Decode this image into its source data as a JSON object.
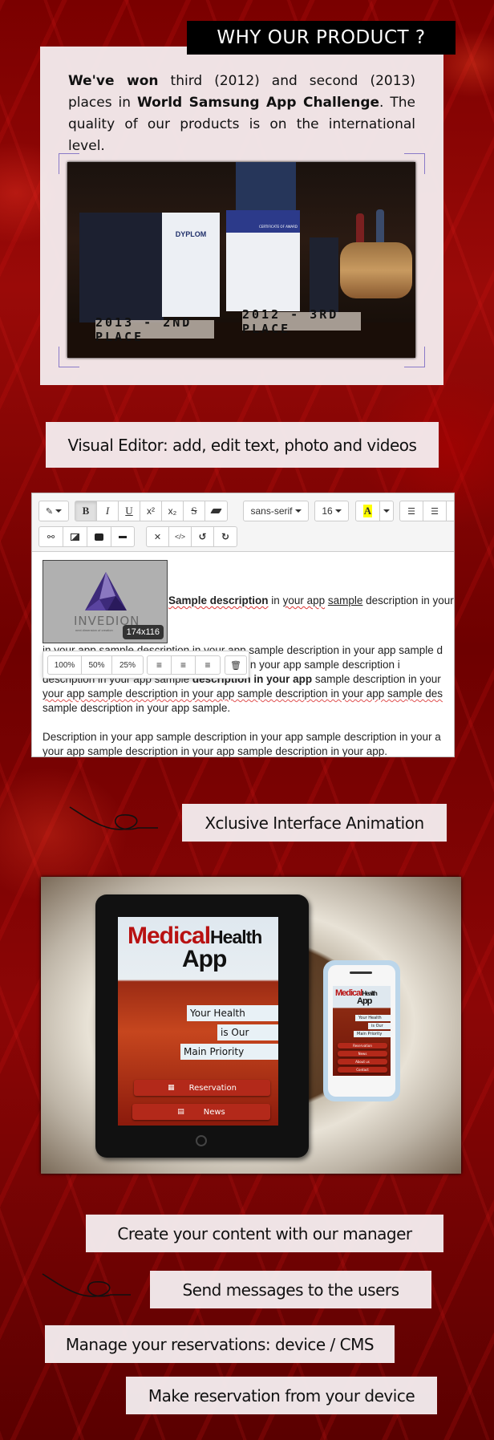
{
  "why_section": {
    "title": "WHY OUR PRODUCT ?",
    "text_bold_1": "We've won",
    "text_1": " third (2012) and second (2013) places in ",
    "text_bold_2": "World Samsung App Challenge",
    "text_2": ". The quality of our products is on the international level.",
    "award_labels": [
      "2013 - 2ND PLACE",
      "2012 - 3RD PLACE"
    ],
    "photo_props": {
      "diploma_title": "DYPLOM",
      "certificate_title": "CERTIFICATE OF AWARD"
    }
  },
  "features": {
    "visual_editor": "Visual Editor: add, edit text, photo and videos",
    "animation": "Xclusive Interface Animation",
    "content_manager": "Create your content with our manager",
    "messages": "Send messages to the users",
    "manage_reservations": "Manage your reservations: device / CMS",
    "make_reservation": "Make reservation from your device"
  },
  "editor": {
    "toolbar": {
      "style_icon": "magic-wand-icon",
      "bold": "B",
      "italic": "I",
      "underline": "U",
      "superscript": "x²",
      "subscript": "x₂",
      "strikethrough": "S",
      "font_family": "sans-serif",
      "font_size": "16",
      "color_letter": "A",
      "highlight_color": "#ffff00"
    },
    "image": {
      "logo_text": "INVEDION",
      "logo_tagline": "next dimension of creation",
      "size_badge": "174x116"
    },
    "image_popover": {
      "sizes": [
        "100%",
        "50%",
        "25%"
      ]
    },
    "content": {
      "heading_bold": "Sample description",
      "heading_rest_a": " in ",
      "heading_rest_b": "your app",
      "heading_rest_c": " ",
      "heading_underlined": "sample",
      "heading_rest_d": " description in your",
      "para1_line1": "in your app sample description in your app sample description in your app sample d",
      "para1_line2": "description in your app sample description in your app sample description i",
      "para1_line3_a": "description in your app sample ",
      "para1_line3_bold": "description in your app",
      "para1_line3_b": " sample description in your",
      "para1_line4": "your app sample description in your app sample description in your app sample des",
      "para1_line5": "sample description in your app sample.",
      "para2_line1": "Description in your app sample description in your app sample description in your a",
      "para2_line2": "your app sample description in your app sample description in your app."
    }
  },
  "devices": {
    "app_title_red": "Medical",
    "app_title_dark": "Health",
    "app_title_app": "App",
    "slogan": [
      "Your Health",
      "is Our",
      "Main Priority"
    ],
    "tablet_buttons": [
      "Reservation",
      "News"
    ],
    "phone_buttons": [
      "Reservation",
      "News",
      "About us",
      "Contact"
    ]
  },
  "colors": {
    "accent_red": "#b81212",
    "title_bg": "#000000",
    "panel_bg": "#f5f0f2"
  }
}
